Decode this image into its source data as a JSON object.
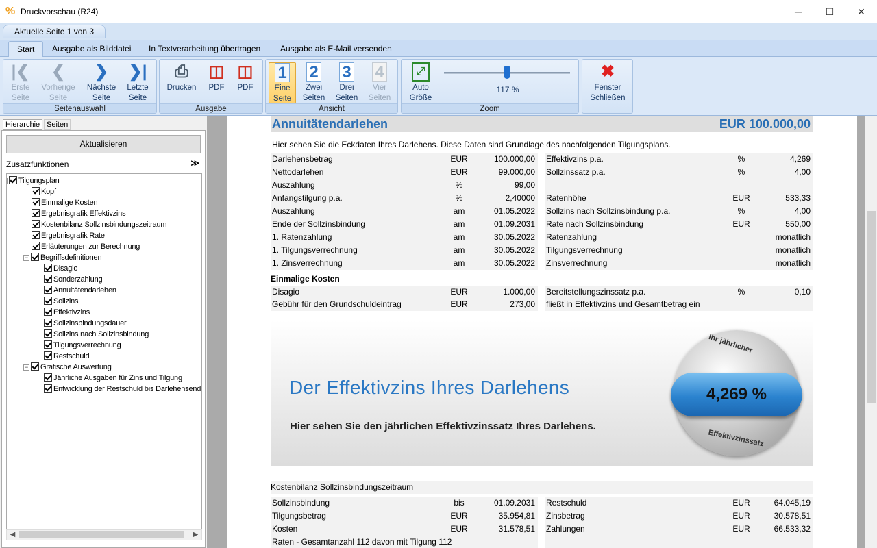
{
  "window": {
    "title": "Druckvorschau (R24)",
    "app_icon": "percent-icon",
    "minimize": "─",
    "maximize": "☐",
    "close": "✕"
  },
  "page_indicator": "Aktuelle Seite 1 von 3",
  "ribbon_tabs": [
    "Start",
    "Ausgabe als Bilddatei",
    "In Textverarbeitung übertragen",
    "Ausgabe als E-Mail versenden"
  ],
  "ribbon": {
    "seitenauswahl": {
      "label": "Seitenauswahl",
      "erste": "Erste\nSeite",
      "vorherige": "Vorherige\nSeite",
      "naechste": "Nächste\nSeite",
      "letzte": "Letzte\nSeite"
    },
    "ausgabe": {
      "label": "Ausgabe",
      "drucken": "Drucken",
      "pdf1": "PDF",
      "pdf2": "PDF"
    },
    "ansicht": {
      "label": "Ansicht",
      "eine": "Eine\nSeite",
      "zwei": "Zwei\nSeiten",
      "drei": "Drei\nSeiten",
      "vier": "Vier\nSeiten",
      "n1": "1",
      "n2": "2",
      "n3": "3",
      "n4": "4"
    },
    "zoom": {
      "label": "Zoom",
      "auto": "Auto\nGröße",
      "value": "117 %",
      "slider_fraction": 0.5
    },
    "close": {
      "label": "Fenster\nSchließen"
    }
  },
  "left_panel": {
    "tab_hierarchie": "Hierarchie",
    "tab_seiten": "Seiten",
    "refresh": "Aktualisieren",
    "zusatz": "Zusatzfunktionen",
    "tree": [
      {
        "label": "Tilgungsplan",
        "level": 0,
        "expander": "−"
      },
      {
        "label": "Kopf",
        "level": 1
      },
      {
        "label": "Einmalige Kosten",
        "level": 1
      },
      {
        "label": "Ergebnisgrafik Effektivzins",
        "level": 1
      },
      {
        "label": "Kostenbilanz Sollzinsbindungszeitraum",
        "level": 1
      },
      {
        "label": "Ergebnisgrafik Rate",
        "level": 1
      },
      {
        "label": "Erläuterungen zur Berechnung",
        "level": 1
      },
      {
        "label": "Begriffsdefinitionen",
        "level": 1,
        "expander": "−"
      },
      {
        "label": "Disagio",
        "level": 2
      },
      {
        "label": "Sonderzahlung",
        "level": 2
      },
      {
        "label": "Annuitätendarlehen",
        "level": 2
      },
      {
        "label": "Sollzins",
        "level": 2
      },
      {
        "label": "Effektivzins",
        "level": 2
      },
      {
        "label": "Sollzinsbindungsdauer",
        "level": 2
      },
      {
        "label": "Sollzins nach Sollzinsbindung",
        "level": 2
      },
      {
        "label": "Tilgungsverrechnung",
        "level": 2
      },
      {
        "label": "Restschuld",
        "level": 2
      },
      {
        "label": "Grafische Auswertung",
        "level": 1,
        "expander": "−"
      },
      {
        "label": "Jährliche Ausgaben für Zins und Tilgung",
        "level": 2
      },
      {
        "label": "Entwicklung der Restschuld bis Darlehensende",
        "level": 2
      }
    ]
  },
  "doc": {
    "title": "Annuitätendarlehen",
    "amount": "EUR 100.000,00",
    "intro": "Hier sehen Sie die Eckdaten Ihres Darlehens. Diese Daten sind Grundlage des nachfolgenden Tilgungsplans.",
    "left_rows": [
      [
        "Darlehensbetrag",
        "EUR",
        "100.000,00"
      ],
      [
        "Nettodarlehen",
        "EUR",
        "99.000,00"
      ],
      [
        "Auszahlung",
        "%",
        "99,00"
      ],
      [
        "Anfangstilgung p.a.",
        "%",
        "2,40000"
      ],
      [
        "Auszahlung",
        "am",
        "01.05.2022"
      ],
      [
        "Ende der Sollzinsbindung",
        "am",
        "01.09.2031"
      ],
      [
        "1. Ratenzahlung",
        "am",
        "30.05.2022"
      ],
      [
        "1. Tilgungsverrechnung",
        "am",
        "30.05.2022"
      ],
      [
        "1. Zinsverrechnung",
        "am",
        "30.05.2022"
      ]
    ],
    "right_rows": [
      [
        "Effektivzins p.a.",
        "%",
        "4,269"
      ],
      [
        "Sollzinssatz p.a.",
        "%",
        "4,00"
      ],
      [
        "",
        "",
        ""
      ],
      [
        "Ratenhöhe",
        "EUR",
        "533,33"
      ],
      [
        "Sollzins nach Sollzinsbindung p.a.",
        "%",
        "4,00"
      ],
      [
        "Rate nach Sollzinsbindung",
        "EUR",
        "550,00"
      ],
      [
        "Ratenzahlung",
        "",
        "monatlich"
      ],
      [
        "Tilgungsverrechnung",
        "",
        "monatlich"
      ],
      [
        "Zinsverrechnung",
        "",
        "monatlich"
      ]
    ],
    "einmalige_title": "Einmalige Kosten",
    "einmalige_left": [
      [
        "Disagio",
        "EUR",
        "1.000,00"
      ],
      [
        "Gebühr für den Grundschuldeintrag",
        "EUR",
        "273,00"
      ]
    ],
    "einmalige_right": [
      [
        "Bereitstellungszinssatz p.a.",
        "%",
        "0,10"
      ],
      [
        "fließt in Effektivzins und Gesamtbetrag ein",
        "",
        ""
      ]
    ],
    "banner": {
      "title": "Der Effektivzins Ihres Darlehens",
      "subtitle": "Hier sehen Sie den jährlichen Effektivzinssatz Ihres Darlehens.",
      "badge_value": "4,269 %",
      "badge_top": "Ihr jährlicher",
      "badge_bottom": "Effektivzinssatz"
    },
    "kosten_title": "Kostenbilanz Sollzinsbindungszeitraum",
    "kosten_left": [
      [
        "Sollzinsbindung",
        "bis",
        "01.09.2031"
      ],
      [
        "Tilgungsbetrag",
        "EUR",
        "35.954,81"
      ],
      [
        "Kosten",
        "EUR",
        "31.578,51"
      ],
      [
        "Raten - Gesamtanzahl 112 davon mit Tilgung 112",
        "",
        ""
      ]
    ],
    "kosten_right": [
      [
        "Restschuld",
        "EUR",
        "64.045,19"
      ],
      [
        "Zinsbetrag",
        "EUR",
        "30.578,51"
      ],
      [
        "Zahlungen",
        "EUR",
        "66.533,32"
      ],
      [
        "",
        "",
        ""
      ]
    ]
  }
}
